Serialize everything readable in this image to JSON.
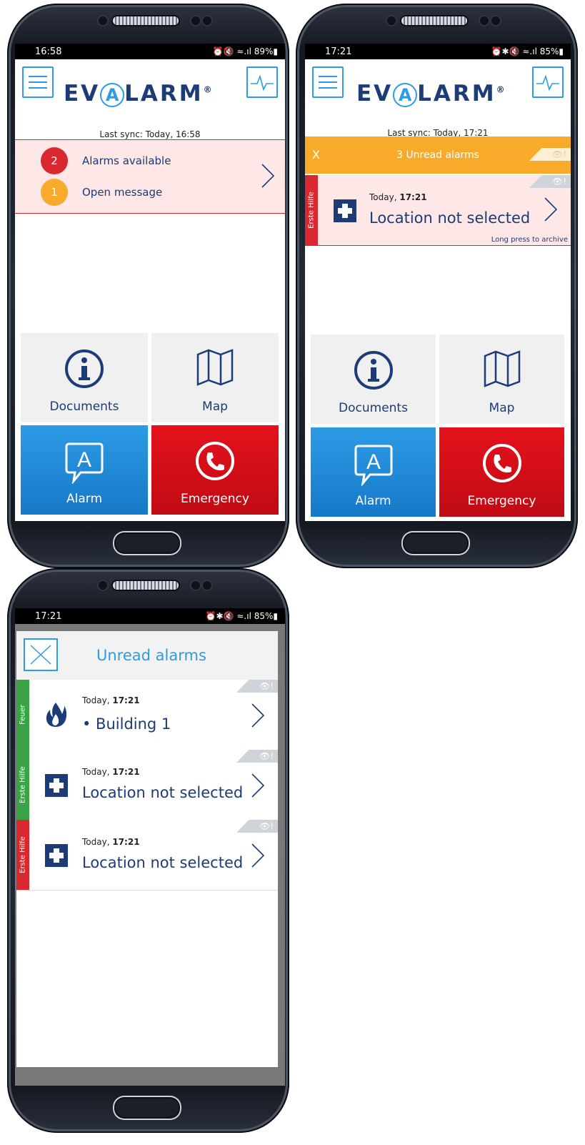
{
  "phone1": {
    "time": "16:58",
    "status_right": "⏰🔇 ≈.ıl 89%▮",
    "logo": {
      "pre": "EV",
      "a": "A",
      "post": "LARM",
      "reg": "®"
    },
    "sync": "Last sync: Today, 16:58",
    "alerts": [
      {
        "count": "2",
        "label": "Alarms available",
        "color": "#d9282f"
      },
      {
        "count": "1",
        "label": "Open message",
        "color": "#f8aa2b"
      }
    ],
    "tiles": {
      "documents": "Documents",
      "map": "Map",
      "alarm": "Alarm",
      "emergency": "Emergency"
    }
  },
  "phone2": {
    "time": "17:21",
    "status_right": "⏰✱🔇 ≈.ıl 85%▮",
    "logo": {
      "pre": "EV",
      "a": "A",
      "post": "LARM",
      "reg": "®"
    },
    "sync": "Last sync: Today, 17:21",
    "unread_bar": {
      "close": "X",
      "text": "3 Unread alarms"
    },
    "card": {
      "stripe": "Erste Hilfe",
      "date": "Today,",
      "time": "17:21",
      "location": "Location not selected",
      "hint": "Long press to archive"
    },
    "tiles": {
      "documents": "Documents",
      "map": "Map",
      "alarm": "Alarm",
      "emergency": "Emergency"
    }
  },
  "phone3": {
    "time": "17:21",
    "status_right": "⏰✱🔇 ≈.ıl 85%▮",
    "modal_title": "Unread alarms",
    "alarms": [
      {
        "stripe": "Feuer",
        "stripe_color": "#3aa346",
        "icon": "fire-icon",
        "date": "Today,",
        "time": "17:21",
        "location": "• Building 1"
      },
      {
        "stripe": "Erste Hilfe",
        "stripe_color": "#3aa346",
        "icon": "first-aid-icon",
        "date": "Today,",
        "time": "17:21",
        "location": "Location not selected"
      },
      {
        "stripe": "Erste Hilfe",
        "stripe_color": "#d9282f",
        "icon": "first-aid-icon",
        "date": "Today,",
        "time": "17:21",
        "location": "Location not selected"
      }
    ]
  },
  "eye_tag": "👁!",
  "colors": {
    "brand_blue": "#2d9be6",
    "navy": "#1c3b77",
    "red": "#d9282f",
    "orange": "#f8aa2b",
    "green": "#3aa346"
  }
}
